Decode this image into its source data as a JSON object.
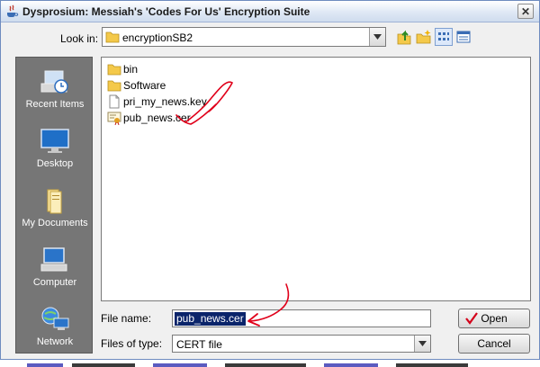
{
  "window": {
    "title": "Dysprosium: Messiah's 'Codes For Us' Encryption Suite",
    "close_label": "✕"
  },
  "look_in": {
    "label": "Look in:",
    "value": "encryptionSB2"
  },
  "places": [
    {
      "label": "Recent Items",
      "icon": "recent-items-icon"
    },
    {
      "label": "Desktop",
      "icon": "desktop-icon"
    },
    {
      "label": "My Documents",
      "icon": "my-documents-icon"
    },
    {
      "label": "Computer",
      "icon": "computer-icon"
    },
    {
      "label": "Network",
      "icon": "network-icon"
    }
  ],
  "files": [
    {
      "name": "bin",
      "type": "folder"
    },
    {
      "name": "Software",
      "type": "folder"
    },
    {
      "name": "pri_my_news.key",
      "type": "file"
    },
    {
      "name": "pub_news.cer",
      "type": "certificate"
    }
  ],
  "file_name": {
    "label": "File name:",
    "value": "pub_news.cer"
  },
  "file_type": {
    "label": "Files of type:",
    "value": "CERT file"
  },
  "buttons": {
    "open": "Open",
    "cancel": "Cancel"
  },
  "colors": {
    "selection": "#0a246a",
    "annotation": "#e0001a",
    "places_bg": "#767676"
  }
}
